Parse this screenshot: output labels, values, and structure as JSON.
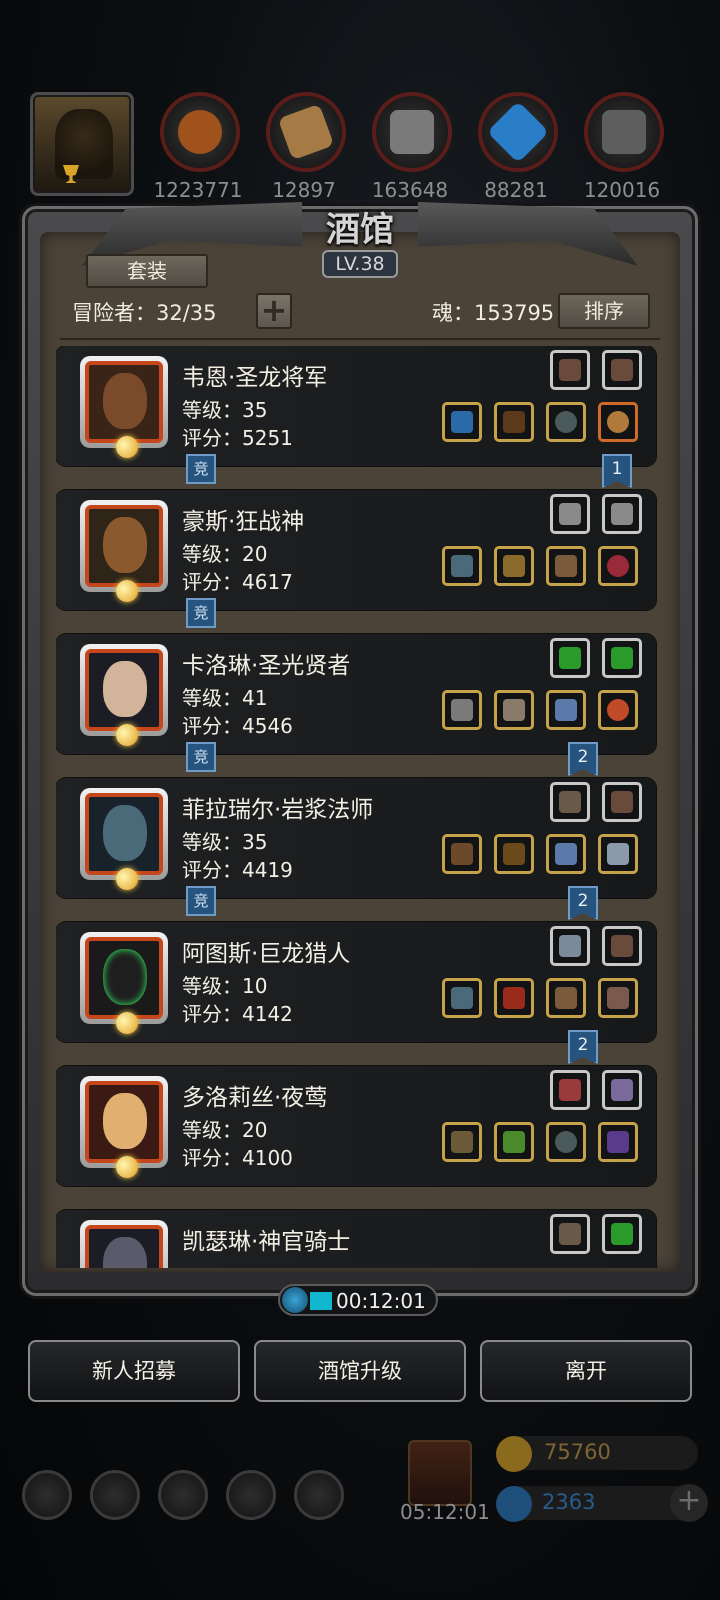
{
  "resources": [
    {
      "name": "meat",
      "value": "1223771",
      "color": "#a0521d"
    },
    {
      "name": "wood",
      "value": "12897",
      "color": "#a57a45"
    },
    {
      "name": "iron",
      "value": "163648",
      "color": "#7a7a7a"
    },
    {
      "name": "crystal",
      "value": "88281",
      "color": "#2a7ec7"
    },
    {
      "name": "steel",
      "value": "120016",
      "color": "#5e5e5e"
    }
  ],
  "tavern": {
    "title": "酒馆",
    "level": "LV.38",
    "suit_button": "套装",
    "adventurers": "冒险者：32/35",
    "add_button": "+",
    "soul": "魂：153795",
    "sort_button": "排序"
  },
  "heroes": [
    {
      "name": "韦恩·圣龙将军",
      "level": "等级：35",
      "score": "评分：5251",
      "tag": "竞",
      "rank": "1",
      "face_color": "#7a4a2a"
    },
    {
      "name": "豪斯·狂战神",
      "level": "等级：20",
      "score": "评分：4617",
      "tag": "竞",
      "rank": "",
      "face_color": "#8a5a2e"
    },
    {
      "name": "卡洛琳·圣光贤者",
      "level": "等级：41",
      "score": "评分：4546",
      "tag": "竞",
      "rank": "2",
      "face_color": "#d2b49a"
    },
    {
      "name": "菲拉瑞尔·岩浆法师",
      "level": "等级：35",
      "score": "评分：4419",
      "tag": "竞",
      "rank": "2",
      "face_color": "#4a6a7a"
    },
    {
      "name": "阿图斯·巨龙猎人",
      "level": "等级：10",
      "score": "评分：4142",
      "tag": "",
      "rank": "2",
      "face_color": "#1e1e1e"
    },
    {
      "name": "多洛莉丝·夜莺",
      "level": "等级：20",
      "score": "评分：4100",
      "tag": "",
      "rank": "",
      "face_color": "#e0b070"
    },
    {
      "name": "凯瑟琳·神官骑士",
      "level": "",
      "score": "",
      "tag": "",
      "rank": "",
      "face_color": "#5a5a6a"
    }
  ],
  "timer": "00:12:01",
  "buttons": {
    "recruit": "新人招募",
    "upgrade": "酒馆升级",
    "leave": "离开"
  },
  "footer": {
    "gift_time": "05:12:01",
    "gold": "75760",
    "gems": "2363",
    "add": "+"
  }
}
